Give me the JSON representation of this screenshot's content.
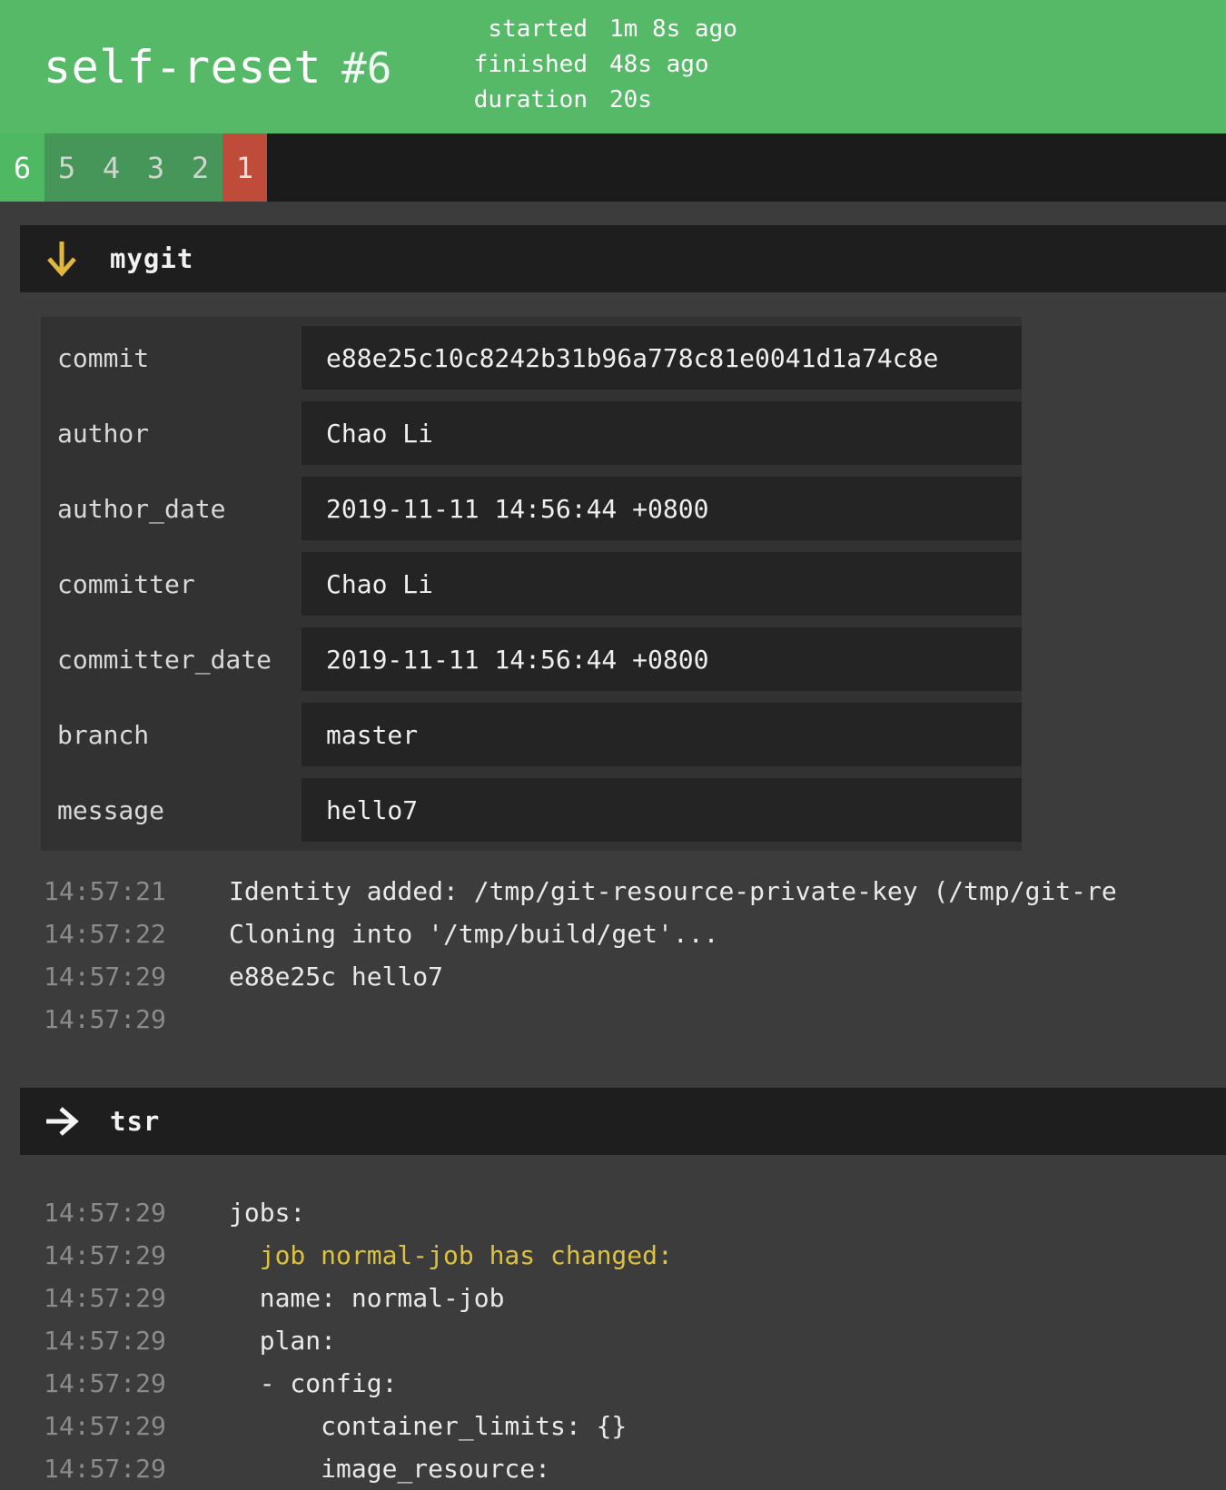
{
  "colors": {
    "page_bg": "#3c3c3c",
    "green": "#55b967",
    "green_tab": "#4fb863",
    "green_muted": "#479659",
    "red": "#bf4b3b",
    "yellow": "#dcc23f",
    "arrow_gold": "#e0b73d"
  },
  "header": {
    "job_name": "self-reset",
    "build_number": "#6",
    "stats": [
      {
        "label": "started",
        "value": "1m 8s ago"
      },
      {
        "label": "finished",
        "value": "48s ago"
      },
      {
        "label": "duration",
        "value": "20s"
      }
    ]
  },
  "history": {
    "builds": [
      {
        "label": "6",
        "status": "current"
      },
      {
        "label": "5",
        "status": "older"
      },
      {
        "label": "4",
        "status": "older"
      },
      {
        "label": "3",
        "status": "older"
      },
      {
        "label": "2",
        "status": "older"
      },
      {
        "label": "1",
        "status": "failed"
      }
    ]
  },
  "steps": [
    {
      "name": "mygit",
      "icon": "arrow-down-icon",
      "metadata": [
        {
          "key": "commit",
          "value": "e88e25c10c8242b31b96a778c81e0041d1a74c8e"
        },
        {
          "key": "author",
          "value": "Chao Li"
        },
        {
          "key": "author_date",
          "value": "2019-11-11 14:56:44 +0800"
        },
        {
          "key": "committer",
          "value": "Chao Li"
        },
        {
          "key": "committer_date",
          "value": "2019-11-11 14:56:44 +0800"
        },
        {
          "key": "branch",
          "value": "master"
        },
        {
          "key": "message",
          "value": "hello7"
        }
      ],
      "logs": [
        {
          "time": "14:57:21",
          "text": "Identity added: /tmp/git-resource-private-key (/tmp/git-re",
          "color": "default"
        },
        {
          "time": "14:57:22",
          "text": "Cloning into '/tmp/build/get'...",
          "color": "default"
        },
        {
          "time": "14:57:29",
          "text": "e88e25c hello7",
          "color": "default"
        },
        {
          "time": "14:57:29",
          "text": "",
          "color": "default"
        }
      ]
    },
    {
      "name": "tsr",
      "icon": "arrow-right-icon",
      "metadata": [],
      "logs": [
        {
          "time": "14:57:29",
          "text": "jobs:",
          "color": "default"
        },
        {
          "time": "14:57:29",
          "text": "  job normal-job has changed:",
          "color": "yellow"
        },
        {
          "time": "14:57:29",
          "text": "  name: normal-job",
          "color": "default"
        },
        {
          "time": "14:57:29",
          "text": "  plan:",
          "color": "default"
        },
        {
          "time": "14:57:29",
          "text": "  - config:",
          "color": "default"
        },
        {
          "time": "14:57:29",
          "text": "      container_limits: {}",
          "color": "default"
        },
        {
          "time": "14:57:29",
          "text": "      image_resource:",
          "color": "default"
        }
      ]
    }
  ]
}
